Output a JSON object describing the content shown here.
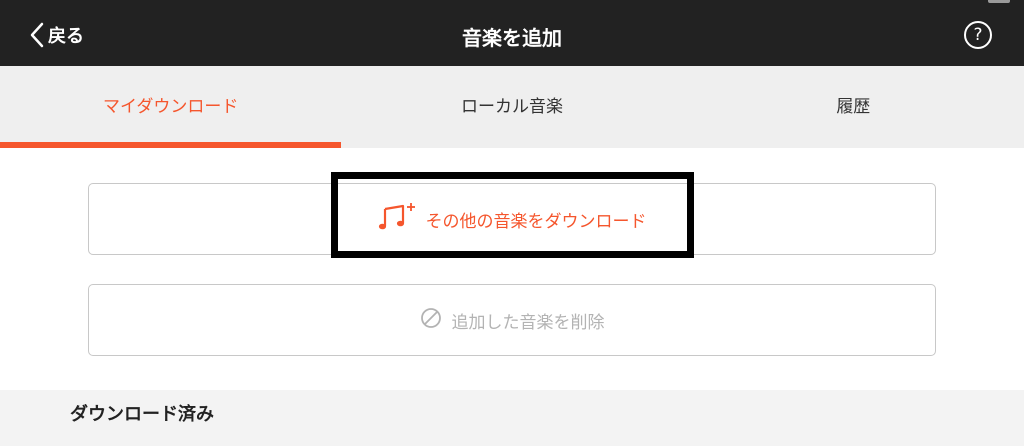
{
  "navbar": {
    "back_label": "戻る",
    "title": "音楽を追加",
    "help_label": "?"
  },
  "tabs": [
    {
      "label": "マイダウンロード",
      "active": true
    },
    {
      "label": "ローカル音楽",
      "active": false
    },
    {
      "label": "履歴",
      "active": false
    }
  ],
  "actions": {
    "download_more_label": "その他の音楽をダウンロード",
    "download_more_icon": "music-note-plus-icon",
    "delete_added_label": "追加した音楽を削除",
    "delete_added_icon": "prohibited-icon"
  },
  "section": {
    "title": "ダウンロード済み"
  },
  "colors": {
    "accent": "#f5562d",
    "navbar_bg": "#222222",
    "tab_bg": "#efefef",
    "disabled_text": "#b3b3b3"
  }
}
